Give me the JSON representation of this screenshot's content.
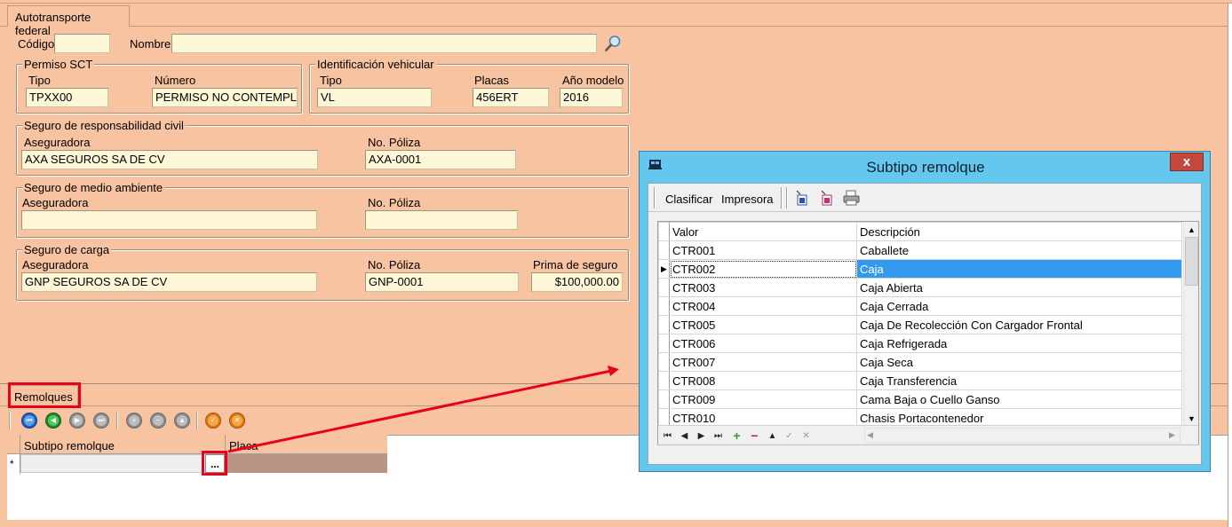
{
  "tabs": {
    "main": "Autotransporte federal",
    "bottom": "Remolques"
  },
  "header": {
    "codigo_label": "Código",
    "codigo_value": "",
    "nombre_label": "Nombre",
    "nombre_value": ""
  },
  "permiso": {
    "title": "Permiso SCT",
    "tipo_label": "Tipo",
    "tipo_value": "TPXX00",
    "numero_label": "Número",
    "numero_value": "PERMISO NO CONTEMPLA"
  },
  "identificacion": {
    "title": "Identificación vehicular",
    "tipo_label": "Tipo",
    "tipo_value": "VL",
    "placas_label": "Placas",
    "placas_value": "456ERT",
    "anio_label": "Año modelo",
    "anio_value": "2016"
  },
  "seguro_rc": {
    "title": "Seguro de responsabilidad civil",
    "aseg_label": "Aseguradora",
    "aseg_value": "AXA SEGUROS SA DE CV",
    "poliza_label": "No. Póliza",
    "poliza_value": "AXA-0001"
  },
  "seguro_ma": {
    "title": "Seguro de medio ambiente",
    "aseg_label": "Aseguradora",
    "aseg_value": "",
    "poliza_label": "No. Póliza",
    "poliza_value": ""
  },
  "seguro_carga": {
    "title": "Seguro de carga",
    "aseg_label": "Aseguradora",
    "aseg_value": "GNP SEGUROS SA DE CV",
    "poliza_label": "No. Póliza",
    "poliza_value": "GNP-0001",
    "prima_label": "Prima de seguro",
    "prima_value": "$100,000.00"
  },
  "remolques_grid": {
    "col1": "Subtipo remolque",
    "col2": "Placa",
    "new_row_marker": "*",
    "ellipsis": "..."
  },
  "dialog": {
    "title": "Subtipo remolque",
    "close": "x",
    "toolbar": {
      "clasificar": "Clasificar",
      "impresora": "Impresora"
    },
    "columns": {
      "valor": "Valor",
      "descripcion": "Descripción"
    },
    "rows": [
      {
        "valor": "CTR001",
        "descripcion": "Caballete"
      },
      {
        "valor": "CTR002",
        "descripcion": "Caja"
      },
      {
        "valor": "CTR003",
        "descripcion": "Caja Abierta"
      },
      {
        "valor": "CTR004",
        "descripcion": "Caja Cerrada"
      },
      {
        "valor": "CTR005",
        "descripcion": "Caja De Recolección Con Cargador Frontal"
      },
      {
        "valor": "CTR006",
        "descripcion": "Caja Refrigerada"
      },
      {
        "valor": "CTR007",
        "descripcion": "Caja Seca"
      },
      {
        "valor": "CTR008",
        "descripcion": "Caja Transferencia"
      },
      {
        "valor": "CTR009",
        "descripcion": "Cama Baja o Cuello Ganso"
      },
      {
        "valor": "CTR010",
        "descripcion": "Chasis Portacontenedor"
      }
    ],
    "selected_index": 1
  },
  "colors": {
    "form_bg": "#f7c3a0",
    "input_bg": "#fdf7d8",
    "dialog_frame": "#64c8ee",
    "highlight": "#e8001c",
    "selection": "#3399ee"
  }
}
